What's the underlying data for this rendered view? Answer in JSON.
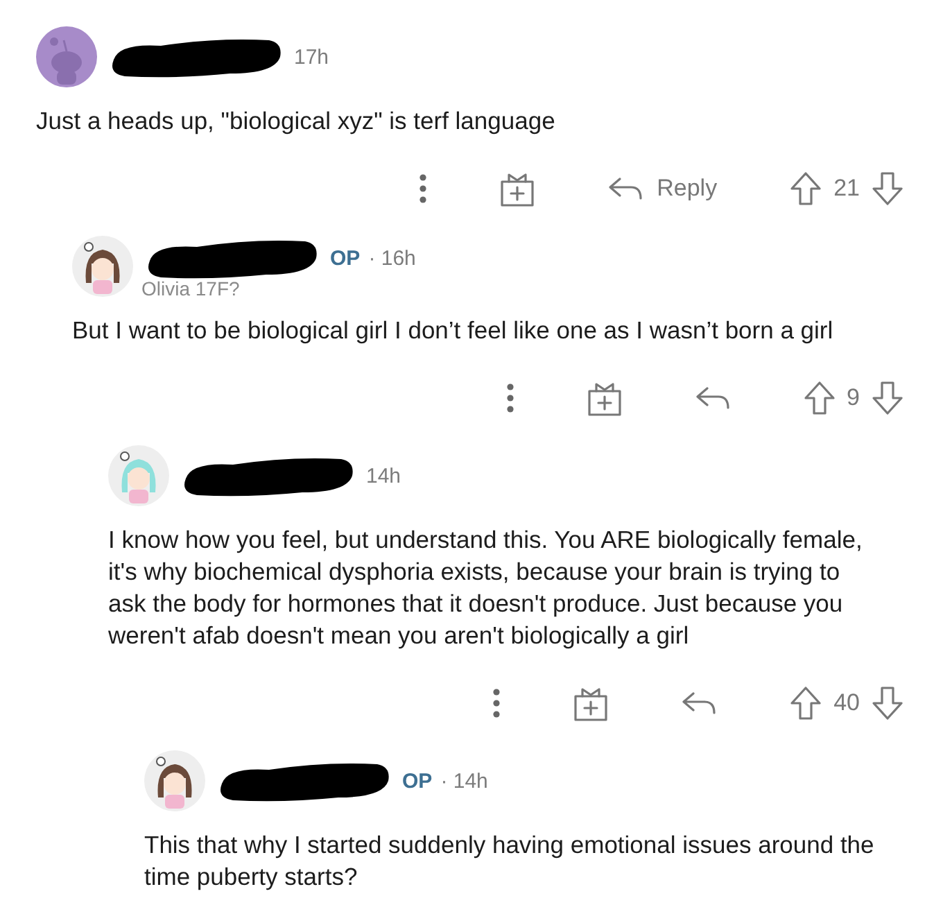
{
  "comments": [
    {
      "avatar": {
        "kind": "snoo",
        "color": "#a78bc9"
      },
      "redacted_name": true,
      "time": "17h",
      "body": "Just a heads up, \"biological xyz\" is terf language",
      "reply_label": "Reply",
      "score": "21",
      "children": [
        {
          "avatar": {
            "kind": "character",
            "color": "#6b4a3a"
          },
          "redacted_name": true,
          "op_label": "OP",
          "time": "· 16h",
          "flair": "Olivia 17F?",
          "body": "But I want to be biological girl I don’t feel like one as I wasn’t born a girl",
          "score": "9",
          "children": [
            {
              "avatar": {
                "kind": "character",
                "color": "#8fe0dc"
              },
              "redacted_name": true,
              "time": "14h",
              "body": "I know how you feel, but understand this. You ARE biologically female, it's why biochemical dysphoria exists, because your brain is trying to ask the body for hormones that it doesn't produce. Just because you weren't afab doesn't mean you aren't biologically a girl",
              "score": "40",
              "children": [
                {
                  "avatar": {
                    "kind": "character",
                    "color": "#6b4a3a"
                  },
                  "redacted_name": true,
                  "op_label": "OP",
                  "time": "· 14h",
                  "body": "This that why I started suddenly having emotional issues around the time puberty starts?"
                }
              ]
            }
          ]
        }
      ]
    }
  ]
}
